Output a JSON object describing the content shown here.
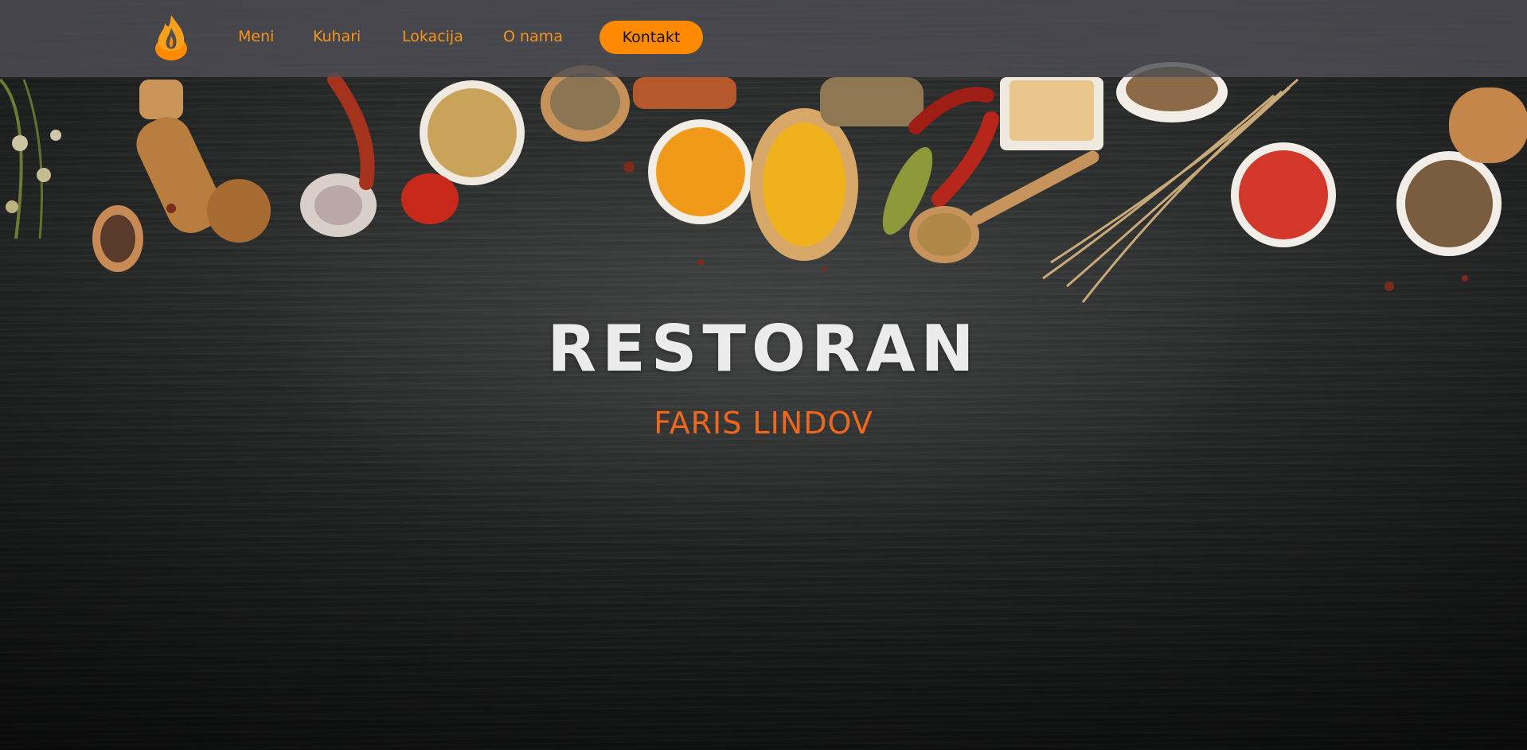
{
  "nav": {
    "logo_icon": "flame-icon",
    "items": [
      {
        "label": "Meni"
      },
      {
        "label": "Kuhari"
      },
      {
        "label": "Lokacija"
      },
      {
        "label": "O nama"
      }
    ],
    "cta_label": "Kontakt"
  },
  "hero": {
    "title": "RESTORAN",
    "subtitle": "FARIS LINDOV",
    "background": "dark-chalkboard-with-spices"
  },
  "colors": {
    "accent": "#ff8a00",
    "nav_text": "#f7941d",
    "subtitle": "#f0661d",
    "title": "#ececec",
    "navbar_bg": "#4e4e54"
  }
}
